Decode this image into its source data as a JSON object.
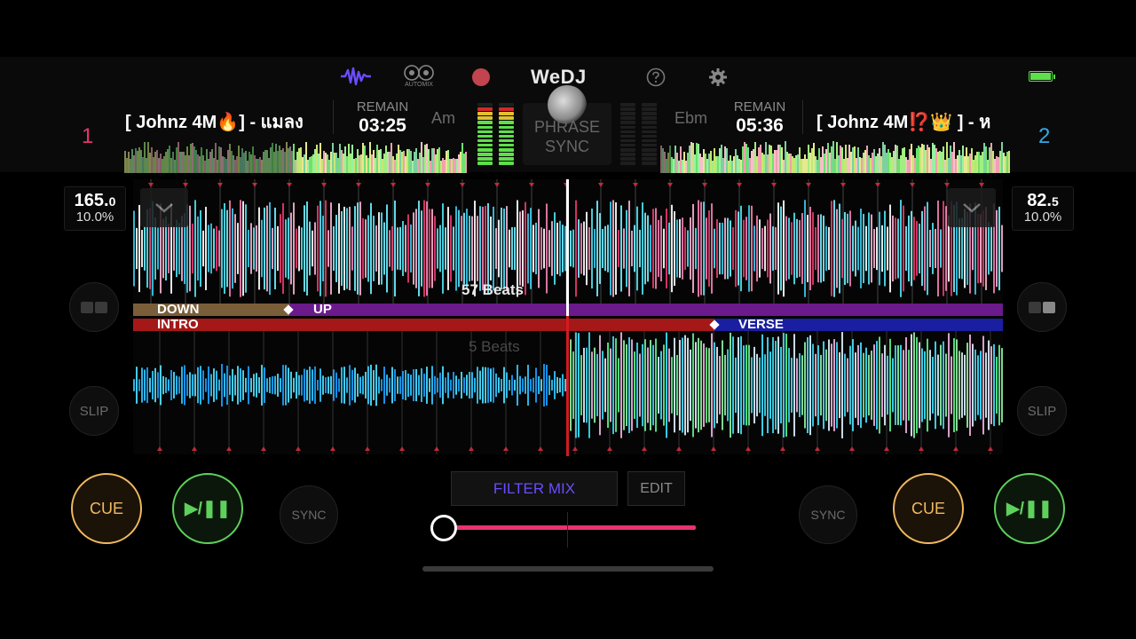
{
  "app": {
    "name": "WeDJ",
    "automix_label": "AUTOMIX"
  },
  "colors": {
    "accent_purple": "#6b4cff",
    "record_red": "#c2444e",
    "cue_orange": "#f0b960",
    "play_green": "#5ed15c",
    "crossfader_pink": "#e8336e",
    "deck1_color": "#e8336e",
    "deck2_color": "#35a8e6",
    "battery_green": "#5ee04a"
  },
  "icons": {
    "waveform": "waveform-icon",
    "automix": "automix-icon",
    "record": "record-icon",
    "help": "help-icon",
    "settings": "gear-icon",
    "battery": "battery-icon",
    "collapse": "chevron-down-icon",
    "pad_mode": "pad-mode-icon"
  },
  "deck1": {
    "number": "1",
    "title": "[ Johnz 4M🔥] - แมลง",
    "remain_label": "REMAIN",
    "remain_time": "03:25",
    "key": "Am",
    "bpm_main": "165.",
    "bpm_decimal": "0",
    "pitch": "10.0%",
    "beats_label": "57 Beats",
    "cue_label": "CUE",
    "play_label": "▶/❚❚",
    "slip_label": "SLIP",
    "sync_label": "SYNC",
    "phrases": {
      "down": "DOWN",
      "up": "UP"
    },
    "meter_level": 0.93
  },
  "deck2": {
    "number": "2",
    "title": "[ Johnz 4M⁉️👑 ] - ห",
    "remain_label": "REMAIN",
    "remain_time": "05:36",
    "key": "Ebm",
    "bpm_main": "82.",
    "bpm_decimal": "5",
    "pitch": "10.0%",
    "beats_label": "5 Beats",
    "cue_label": "CUE",
    "play_label": "▶/❚❚",
    "slip_label": "SLIP",
    "sync_label": "SYNC",
    "phrases": {
      "intro": "INTRO",
      "verse": "VERSE"
    },
    "meter_level": 0
  },
  "center": {
    "phrase_sync_line1": "PHRASE",
    "phrase_sync_line2": "SYNC",
    "filter_mix_label": "FILTER MIX",
    "edit_label": "EDIT",
    "crossfader_position": 0.0
  }
}
